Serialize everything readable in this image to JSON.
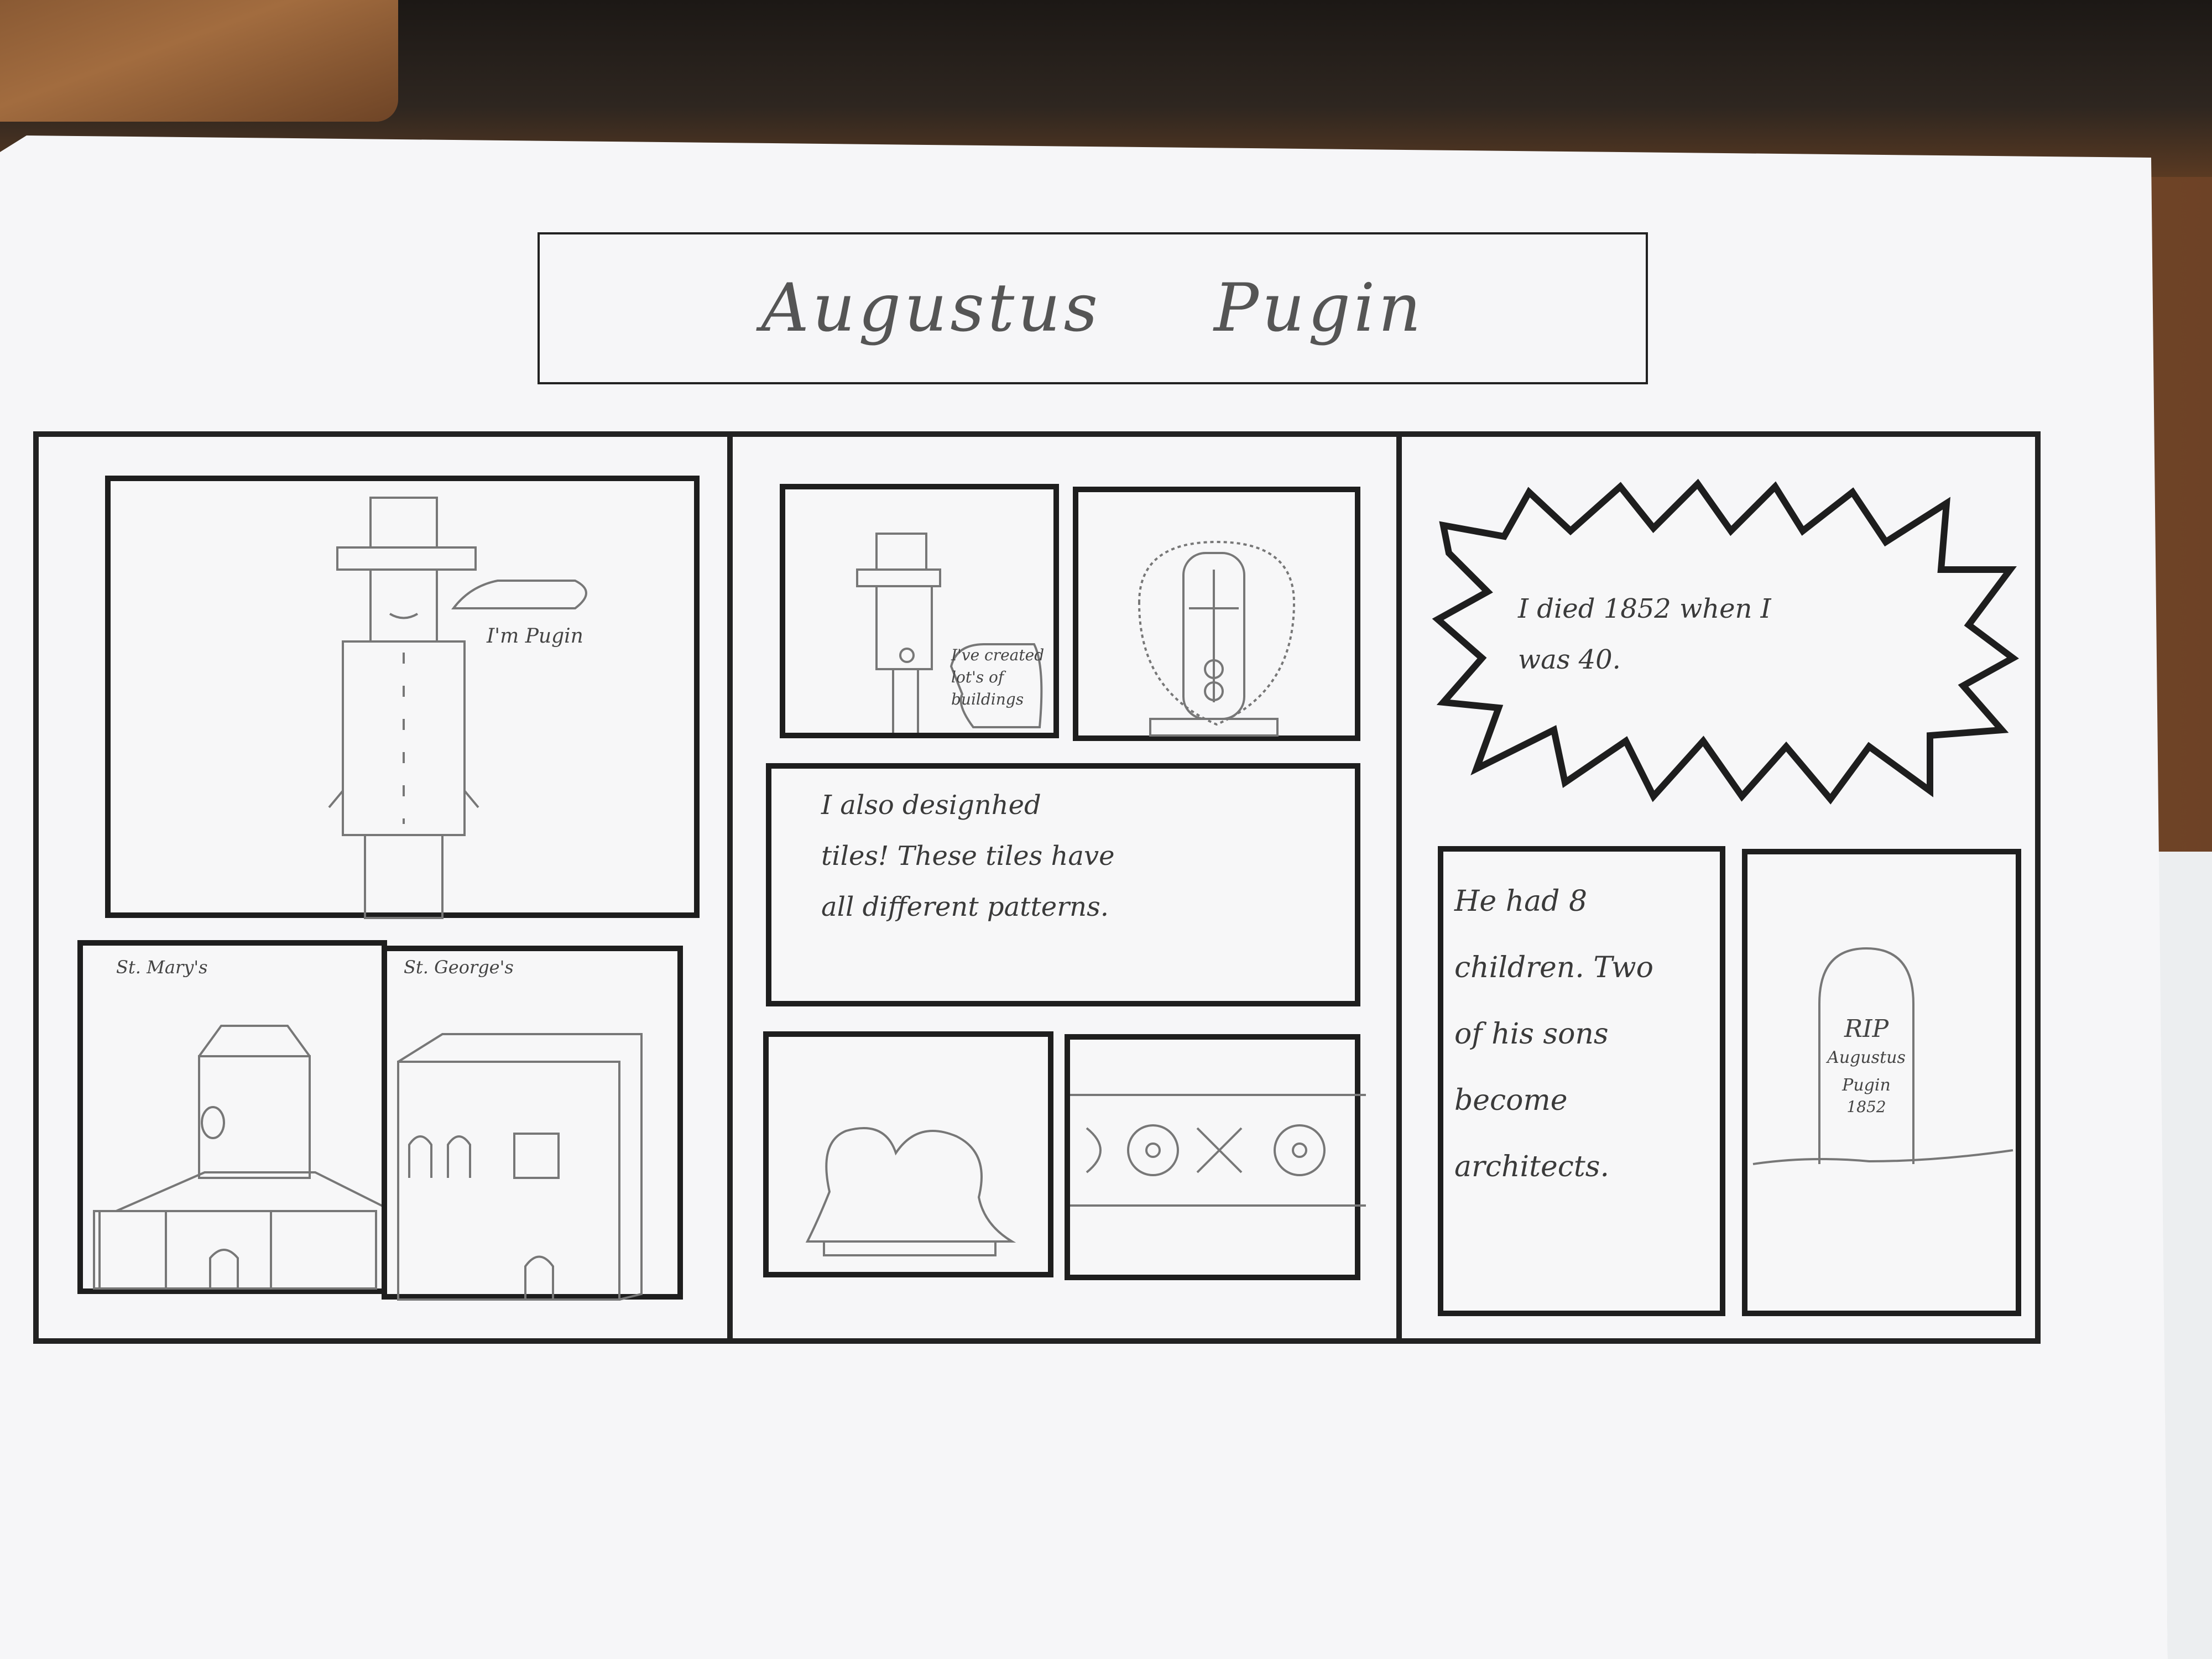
{
  "title": "Augustus    Pugin",
  "panels": {
    "pugin_intro": {
      "speech": "I'm Pugin"
    },
    "st_marys": {
      "label": "St. Mary's"
    },
    "st_georges": {
      "label": "St. George's"
    },
    "buildings": {
      "speech": "I've created lot's of buildings"
    },
    "tiles_caption": {
      "text": "I also designhed\ntiles! These tiles have\nall different patterns."
    },
    "death_burst": {
      "text": "I died 1852 when I\nwas 40."
    },
    "children_caption": {
      "text": "He had 8\nchildren. Two\nof his sons\nbecome\narchitects."
    },
    "grave": {
      "line1": "RIP",
      "line2": "Augustus",
      "line3": "Pugin",
      "line4": "1852"
    }
  }
}
